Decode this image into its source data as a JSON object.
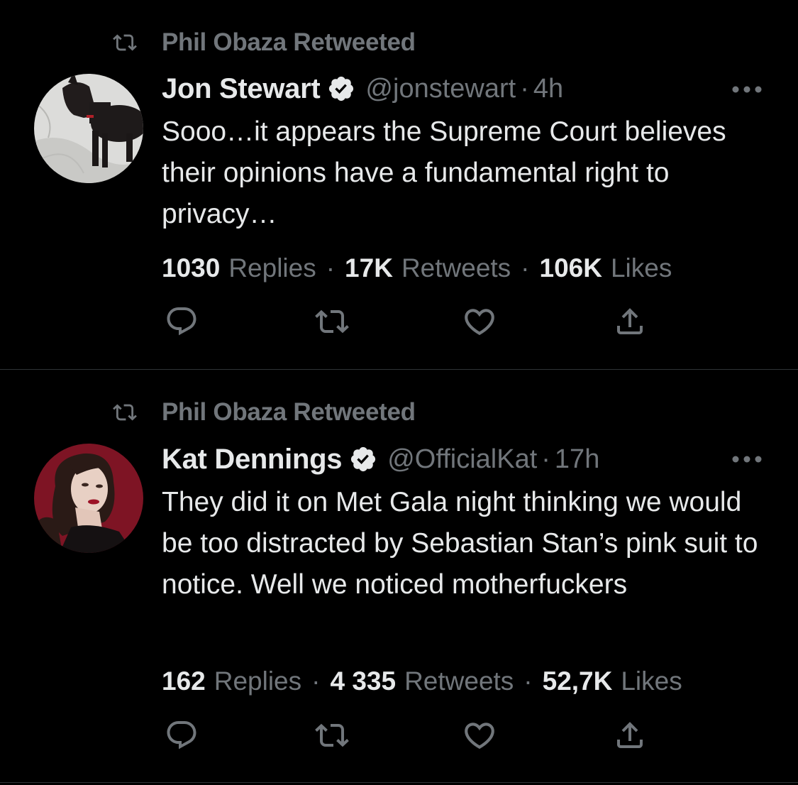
{
  "colors": {
    "background": "#000000",
    "primary_text": "#e7e9ea",
    "secondary_text": "#71767b",
    "divider": "#2f3336"
  },
  "tweets": [
    {
      "retweeted_by": "Phil Obaza Retweeted",
      "author_name": "Jon Stewart",
      "handle": "@jonstewart",
      "separator": "·",
      "time": "4h",
      "verified": true,
      "avatar": "dog-in-snow-photo",
      "text": "Sooo…it appears the Supreme Court believes their opinions have a fundamental right to privacy…",
      "stats": {
        "replies_count": "1030",
        "replies_label": "Replies",
        "retweets_count": "17K",
        "retweets_label": "Retweets",
        "likes_count": "106K",
        "likes_label": "Likes",
        "separator": "·"
      },
      "actions": [
        "reply-icon",
        "retweet-icon",
        "like-icon",
        "share-icon"
      ]
    },
    {
      "retweeted_by": "Phil Obaza Retweeted",
      "author_name": "Kat Dennings",
      "handle": "@OfficialKat",
      "separator": "·",
      "time": "17h",
      "verified": true,
      "avatar": "portrait-photo-red-background",
      "text": "They did it on Met Gala night thinking we would be too distracted by Sebastian Stan’s pink suit to notice. Well we noticed motherfuckers",
      "stats": {
        "replies_count": "162",
        "replies_label": "Replies",
        "retweets_count": "4 335",
        "retweets_label": "Retweets",
        "likes_count": "52,7K",
        "likes_label": "Likes",
        "separator": "·"
      },
      "actions": [
        "reply-icon",
        "retweet-icon",
        "like-icon",
        "share-icon"
      ]
    }
  ]
}
